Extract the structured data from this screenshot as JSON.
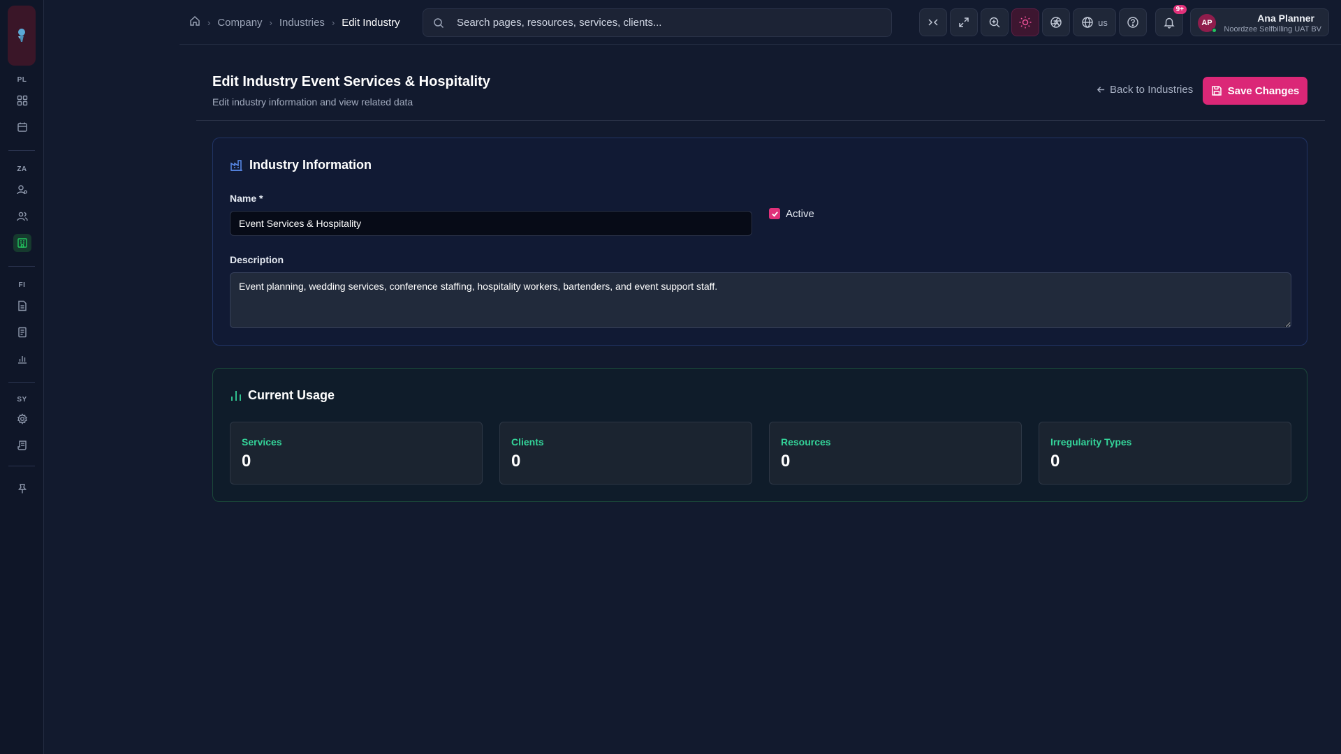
{
  "sidebar": {
    "sections": [
      {
        "label": "PL"
      },
      {
        "label": "ZA"
      },
      {
        "label": "FI"
      },
      {
        "label": "SY"
      }
    ]
  },
  "breadcrumb": {
    "items": [
      "Company",
      "Industries",
      "Edit Industry"
    ]
  },
  "search": {
    "placeholder": "Search pages, resources, services, clients..."
  },
  "toolbar": {
    "language": "us",
    "notification_badge": "9+"
  },
  "user": {
    "initials": "AP",
    "name": "Ana Planner",
    "org": "Noordzee Selfbilling UAT BV"
  },
  "header": {
    "title": "Edit Industry Event Services & Hospitality",
    "subtitle": "Edit industry information and view related data",
    "back_label": "Back to Industries",
    "save_label": "Save Changes"
  },
  "info_card": {
    "title": "Industry Information",
    "name_label": "Name *",
    "name_value": "Event Services & Hospitality",
    "active_label": "Active",
    "active_checked": true,
    "description_label": "Description",
    "description_value": "Event planning, wedding services, conference staffing, hospitality workers, bartenders, and event support staff."
  },
  "usage_card": {
    "title": "Current Usage",
    "stats": [
      {
        "label": "Services",
        "value": "0"
      },
      {
        "label": "Clients",
        "value": "0"
      },
      {
        "label": "Resources",
        "value": "0"
      },
      {
        "label": "Irregularity Types",
        "value": "0"
      }
    ]
  },
  "colors": {
    "accent": "#db2777",
    "success": "#34d399",
    "background": "#121a2e"
  }
}
